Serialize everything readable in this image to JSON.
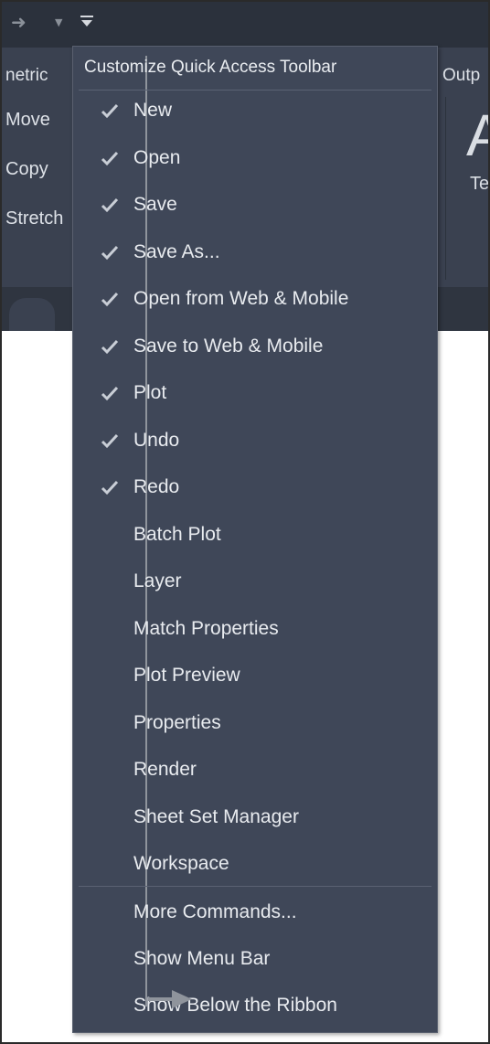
{
  "qat": {
    "customize_icon": "customize-dropdown-icon",
    "arrow_icon": "redo-arrow-icon"
  },
  "ribbon": {
    "tab_left": "netric",
    "tab_right": "Outp",
    "commands": [
      "Move",
      "Copy",
      "Stretch"
    ],
    "big_letter": "A",
    "small_label": "Te"
  },
  "menu": {
    "title": "Customize Quick Access Toolbar",
    "items": [
      {
        "label": "New",
        "checked": true
      },
      {
        "label": "Open",
        "checked": true
      },
      {
        "label": "Save",
        "checked": true
      },
      {
        "label": "Save As...",
        "checked": true
      },
      {
        "label": "Open from Web & Mobile",
        "checked": true
      },
      {
        "label": "Save to Web & Mobile",
        "checked": true
      },
      {
        "label": "Plot",
        "checked": true
      },
      {
        "label": "Undo",
        "checked": true
      },
      {
        "label": "Redo",
        "checked": true
      },
      {
        "label": "Batch Plot",
        "checked": false
      },
      {
        "label": "Layer",
        "checked": false
      },
      {
        "label": "Match Properties",
        "checked": false
      },
      {
        "label": "Plot Preview",
        "checked": false
      },
      {
        "label": "Properties",
        "checked": false
      },
      {
        "label": "Render",
        "checked": false
      },
      {
        "label": "Sheet Set Manager",
        "checked": false
      },
      {
        "label": "Workspace",
        "checked": false
      }
    ],
    "extra_items": [
      {
        "label": "More Commands..."
      },
      {
        "label": "Show Menu Bar"
      },
      {
        "label": "Show Below the Ribbon"
      }
    ]
  },
  "colors": {
    "menu_bg": "#3f4758",
    "text": "#e8ebef",
    "check": "#c9ced6"
  }
}
